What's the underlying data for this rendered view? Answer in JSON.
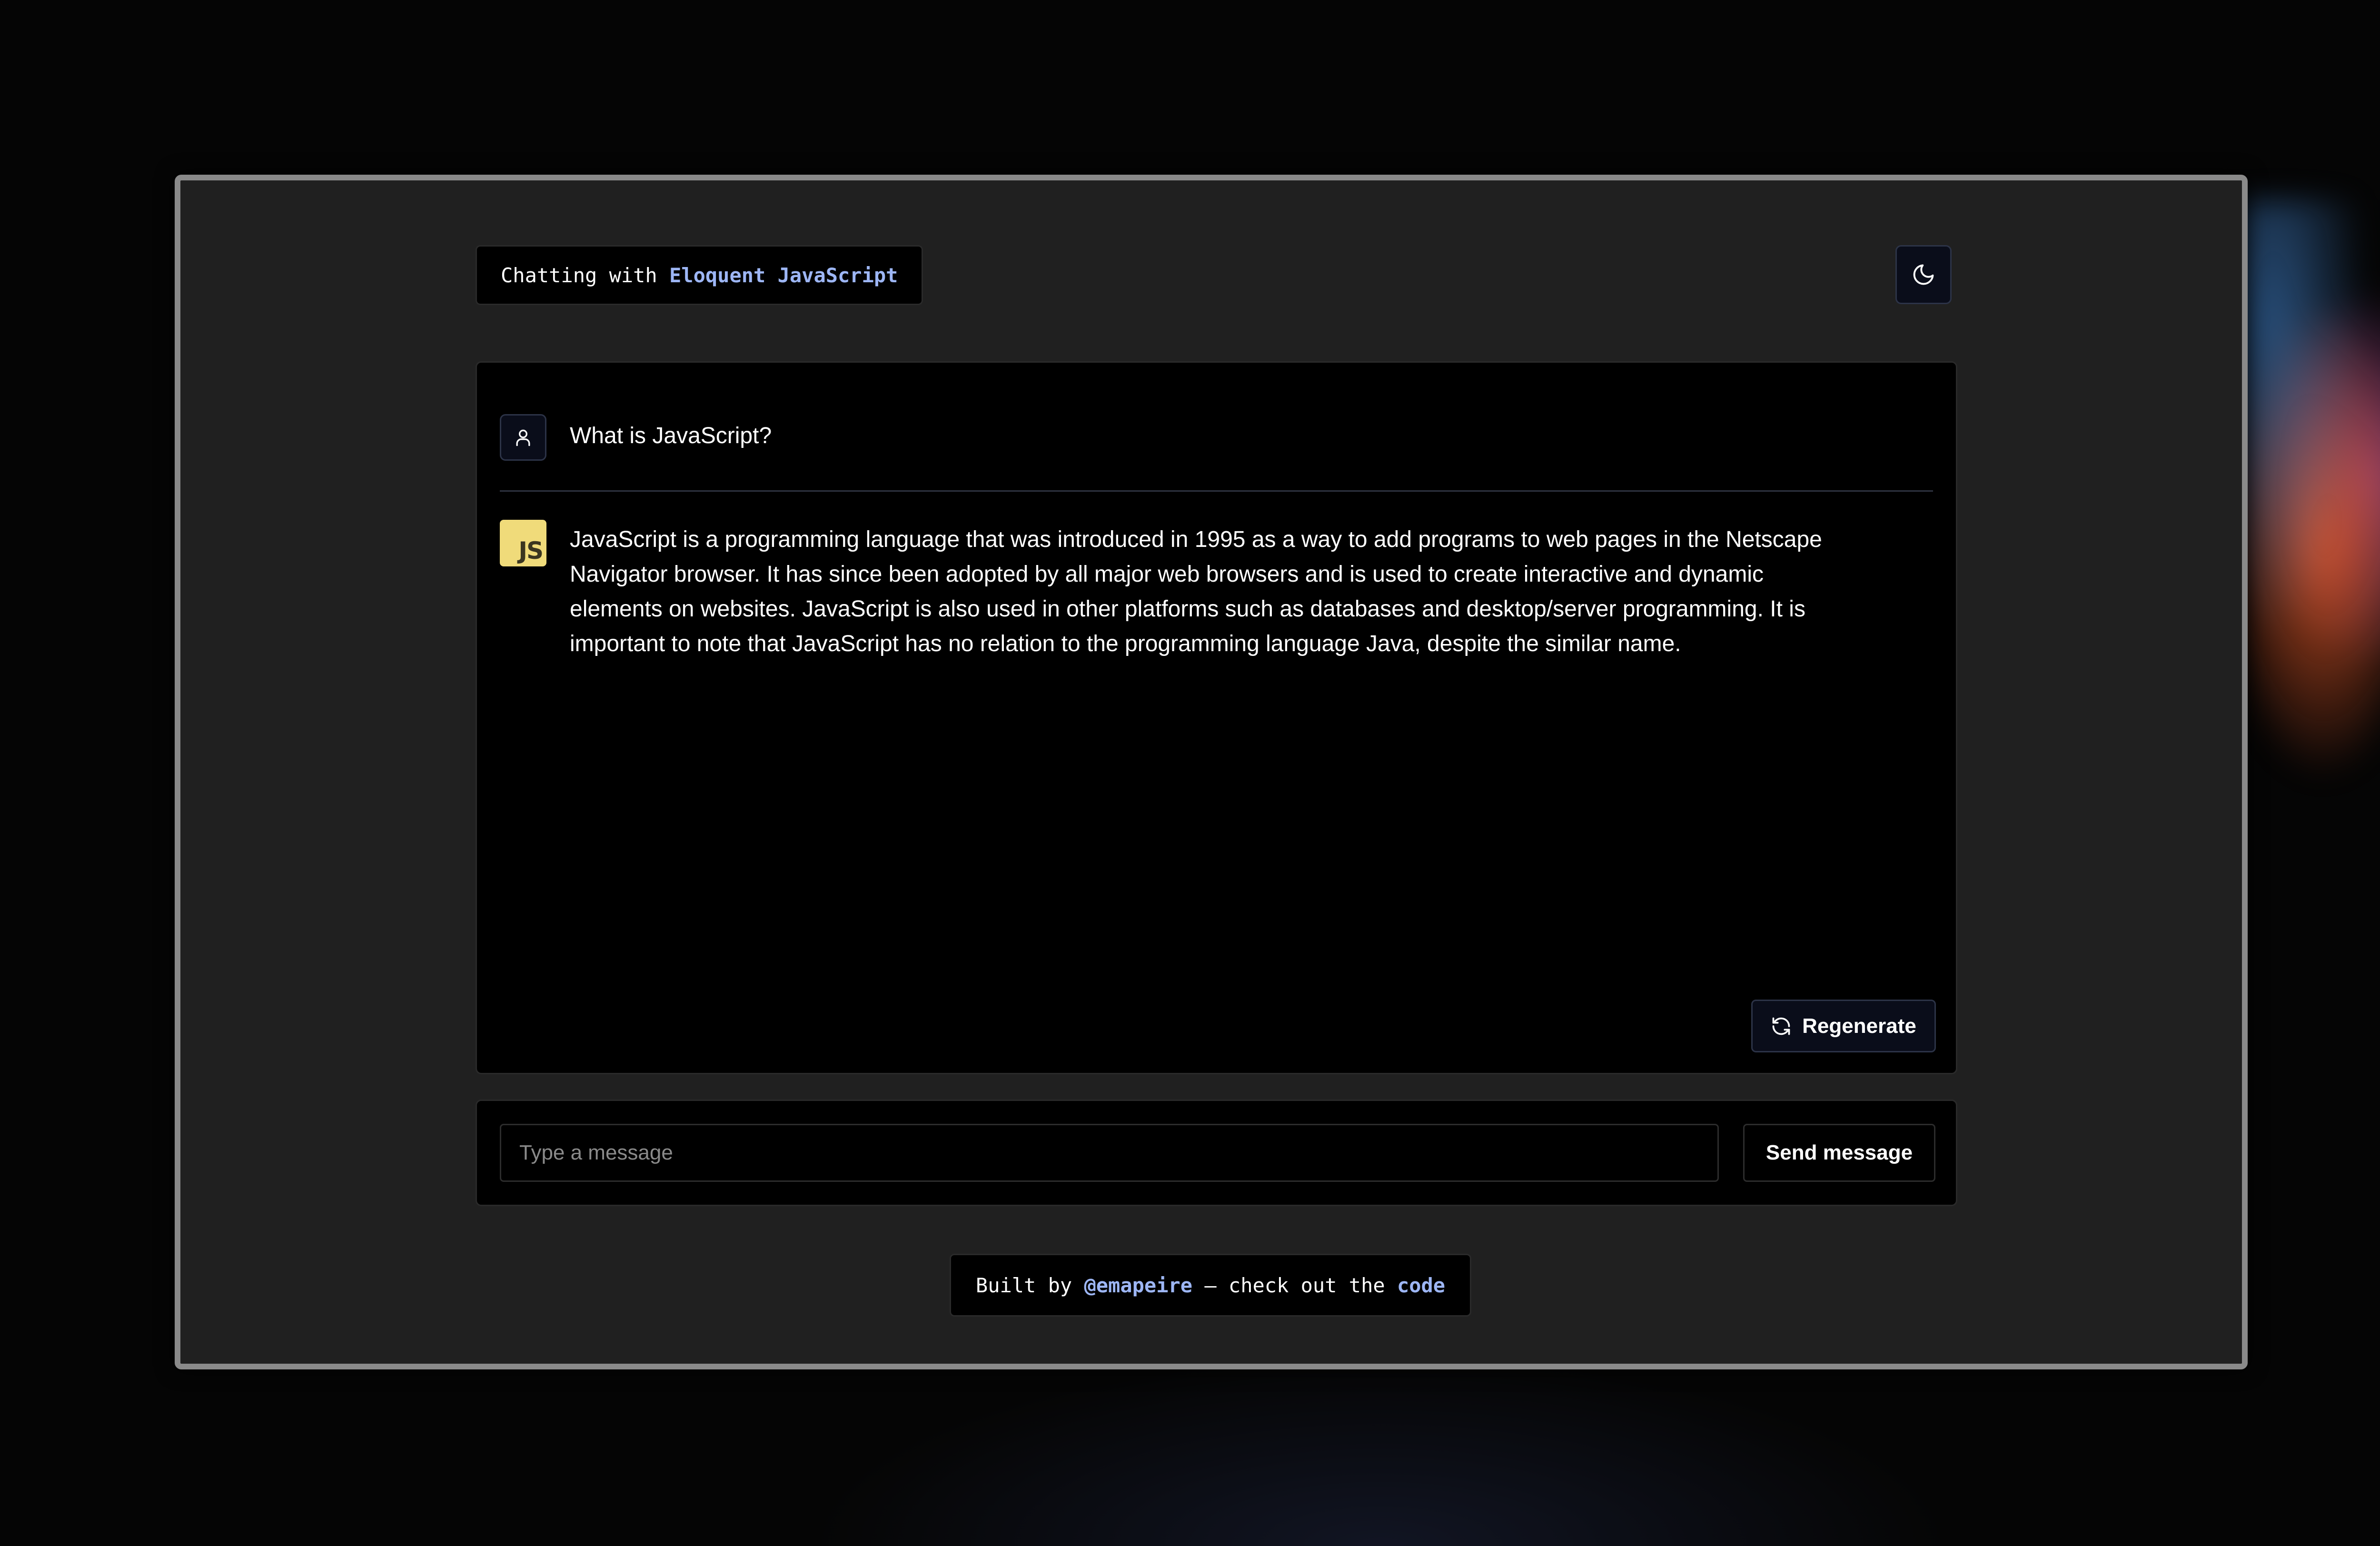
{
  "header": {
    "prefix": "Chatting with ",
    "book_title": "Eloquent JavaScript"
  },
  "theme_toggle": {
    "icon": "moon-icon"
  },
  "chat": {
    "user_icon": "user-icon",
    "user_message": "What is JavaScript?",
    "bot_avatar_text": "JS",
    "bot_message": "JavaScript is a programming language that was introduced in 1995 as a way to add programs to web pages in the Netscape Navigator browser. It has since been adopted by all major web browsers and is used to create interactive and dynamic elements on websites. JavaScript is also used in other platforms such as databases and desktop/server programming. It is important to note that JavaScript has no relation to the programming language Java, despite the similar name.",
    "regenerate_icon": "refresh-icon",
    "regenerate_label": "Regenerate"
  },
  "composer": {
    "value": "",
    "placeholder": "Type a message",
    "send_label": "Send message"
  },
  "footer": {
    "prefix": "Built by ",
    "author": "@emapeire",
    "middle": " – check out the ",
    "code_link": "code"
  },
  "colors": {
    "accent": "#9db6f5",
    "panel": "#000000",
    "window_bg": "#202020",
    "js_badge": "#f0db7a"
  }
}
